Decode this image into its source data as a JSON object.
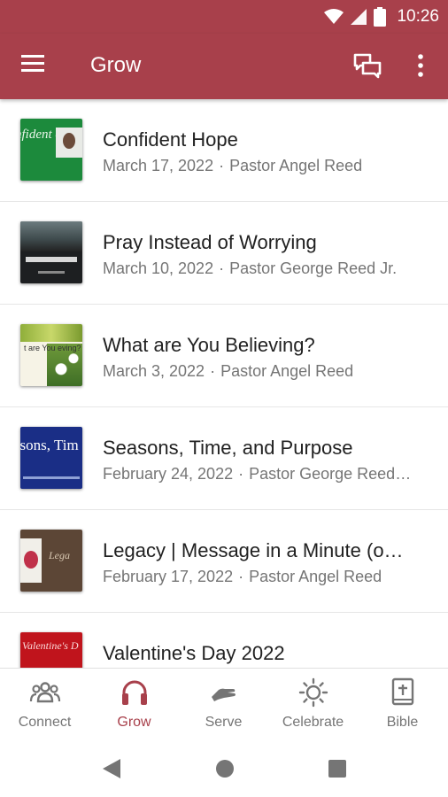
{
  "status_bar": {
    "time": "10:26"
  },
  "app_bar": {
    "title": "Grow"
  },
  "list": {
    "items": [
      {
        "title": "Confident Hope",
        "date": "March 17, 2022",
        "speaker": "Pastor Angel Reed",
        "thumb_text": "nfident e"
      },
      {
        "title": "Pray Instead of Worrying",
        "date": "March 10, 2022",
        "speaker": "Pastor George Reed Jr.",
        "thumb_text": ""
      },
      {
        "title": "What are You Believing?",
        "date": "March 3, 2022",
        "speaker": "Pastor Angel Reed",
        "thumb_text": "t are You eving?"
      },
      {
        "title": "Seasons, Time, and Purpose",
        "date": "February 24, 2022",
        "speaker": "Pastor George Reed…",
        "thumb_text": "asons, Tim nd Purpos"
      },
      {
        "title": "Legacy | Message in a Minute (o…",
        "date": "February 17, 2022",
        "speaker": "Pastor Angel Reed",
        "thumb_text": "Lega"
      },
      {
        "title": "Valentine's Day 2022",
        "date": "",
        "speaker": "",
        "thumb_text": "Valentine's D"
      }
    ]
  },
  "bottom_nav": {
    "items": [
      {
        "label": "Connect",
        "icon": "people-icon",
        "active": false
      },
      {
        "label": "Grow",
        "icon": "headphones-icon",
        "active": true
      },
      {
        "label": "Serve",
        "icon": "hand-icon",
        "active": false
      },
      {
        "label": "Celebrate",
        "icon": "sun-icon",
        "active": false
      },
      {
        "label": "Bible",
        "icon": "bible-icon",
        "active": false
      }
    ]
  },
  "colors": {
    "primary": "#a8404b",
    "text": "#212121",
    "secondary_text": "#757575",
    "inactive_icon": "#757575"
  }
}
